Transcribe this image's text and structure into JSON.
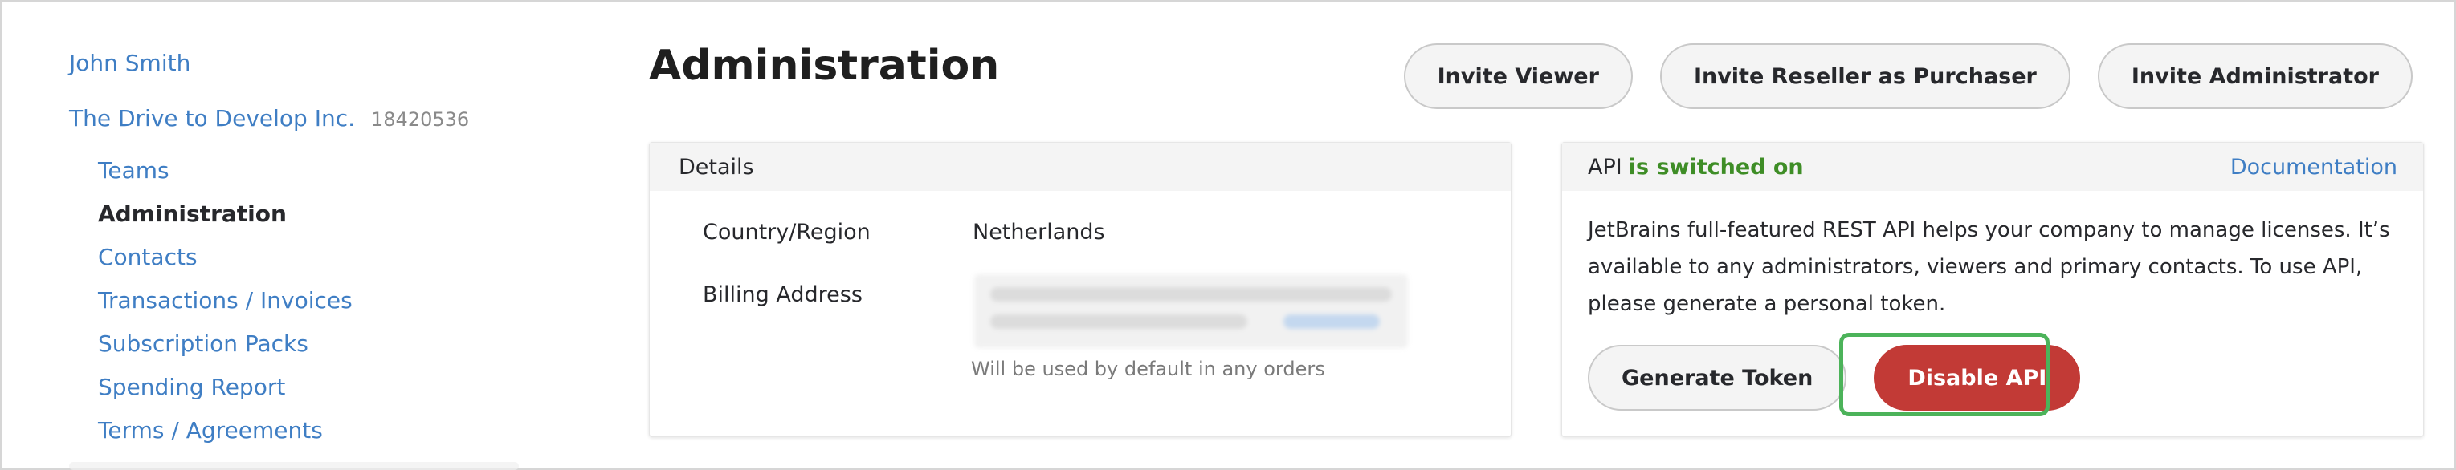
{
  "sidebar": {
    "user_name": "John Smith",
    "company_name": "The Drive to Develop Inc.",
    "company_id": "18420536",
    "items": [
      {
        "label": "Teams"
      },
      {
        "label": "Administration"
      },
      {
        "label": "Contacts"
      },
      {
        "label": "Transactions / Invoices"
      },
      {
        "label": "Subscription Packs"
      },
      {
        "label": "Spending Report"
      },
      {
        "label": "Terms / Agreements"
      }
    ],
    "active_item": "Administration"
  },
  "header": {
    "title": "Administration",
    "buttons": {
      "invite_viewer": "Invite Viewer",
      "invite_reseller": "Invite Reseller as Purchaser",
      "invite_admin": "Invite Administrator"
    }
  },
  "details": {
    "title": "Details",
    "fields": [
      {
        "label": "Country/Region",
        "value": "Netherlands"
      },
      {
        "label": "Billing Address",
        "value": ""
      }
    ],
    "billing_note": "Will be used by default in any orders"
  },
  "api": {
    "status_label": "API",
    "status_value": "is switched on",
    "documentation_link": "Documentation",
    "description": "JetBrains full-featured REST API helps your company to manage licenses. It’s available to any administrators, viewers and primary contacts. To use API, please generate a personal token.",
    "generate_token_label": "Generate Token",
    "disable_api_label": "Disable API"
  },
  "colors": {
    "link": "#3f7ec4",
    "status_on": "#3e8d26",
    "danger": "#c23a36",
    "highlight": "#4cb35a"
  }
}
